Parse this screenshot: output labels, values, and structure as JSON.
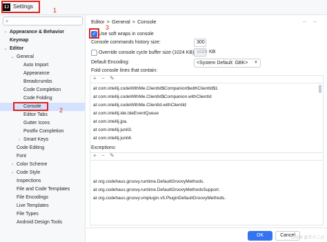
{
  "window": {
    "title": "Settings",
    "app_icon": "IJ"
  },
  "annotations": {
    "n1": "1",
    "n2": "2",
    "n3": "3"
  },
  "sidebar": {
    "items": [
      {
        "label": "Appearance & Behavior",
        "chev": ">",
        "bold": true,
        "indent": 0
      },
      {
        "label": "Keymap",
        "chev": "",
        "bold": true,
        "indent": 0
      },
      {
        "label": "Editor",
        "chev": "v",
        "bold": true,
        "indent": 0
      },
      {
        "label": "General",
        "chev": "v",
        "bold": false,
        "indent": 1
      },
      {
        "label": "Auto Import",
        "chev": "",
        "bold": false,
        "indent": 2
      },
      {
        "label": "Appearance",
        "chev": "",
        "bold": false,
        "indent": 2
      },
      {
        "label": "Breadcrumbs",
        "chev": "",
        "bold": false,
        "indent": 2
      },
      {
        "label": "Code Completion",
        "chev": "",
        "bold": false,
        "indent": 2
      },
      {
        "label": "Code Folding",
        "chev": "",
        "bold": false,
        "indent": 2
      },
      {
        "label": "Console",
        "chev": "",
        "bold": false,
        "indent": 2,
        "selected": true
      },
      {
        "label": "Editor Tabs",
        "chev": "",
        "bold": false,
        "indent": 2
      },
      {
        "label": "Gutter Icons",
        "chev": "",
        "bold": false,
        "indent": 2
      },
      {
        "label": "Postfix Completion",
        "chev": "",
        "bold": false,
        "indent": 2
      },
      {
        "label": "Smart Keys",
        "chev": ">",
        "bold": false,
        "indent": 2
      },
      {
        "label": "Code Editing",
        "chev": "",
        "bold": false,
        "indent": 1
      },
      {
        "label": "Font",
        "chev": "",
        "bold": false,
        "indent": 1
      },
      {
        "label": "Color Scheme",
        "chev": ">",
        "bold": false,
        "indent": 1
      },
      {
        "label": "Code Style",
        "chev": ">",
        "bold": false,
        "indent": 1
      },
      {
        "label": "Inspections",
        "chev": "",
        "bold": false,
        "indent": 1
      },
      {
        "label": "File and Code Templates",
        "chev": "",
        "bold": false,
        "indent": 1
      },
      {
        "label": "File Encodings",
        "chev": "",
        "bold": false,
        "indent": 1
      },
      {
        "label": "Live Templates",
        "chev": "",
        "bold": false,
        "indent": 1
      },
      {
        "label": "File Types",
        "chev": "",
        "bold": false,
        "indent": 1
      },
      {
        "label": "Android Design Tools",
        "chev": "",
        "bold": false,
        "indent": 1
      }
    ]
  },
  "breadcrumb": [
    "Editor",
    ">",
    "General",
    ">",
    "Console"
  ],
  "nav": {
    "back": "←",
    "forward": "→"
  },
  "settings": {
    "soft_wraps_label": "Use soft wraps in console",
    "soft_wraps_checked": true,
    "history_label": "Console commands history size:",
    "history_value": "300",
    "override_label": "Override console cycle buffer size (1024 KB):",
    "override_checked": false,
    "buffer_value": "1024",
    "buffer_unit": "KB",
    "encoding_label": "Default Encoding:",
    "encoding_value": "<System Default: GBK>",
    "fold_label": "Fold console lines that contain:",
    "exceptions_label": "Exceptions:"
  },
  "toolbar": {
    "add": "+",
    "remove": "−",
    "edit": "✎"
  },
  "fold_lines": [
    "at com.intellij.codeWithMe.ClientId$Companion$withClientId$1",
    "at com.intellij.codeWithMe.ClientId$Companion.withClientId",
    "at com.intellij.codeWithMe.ClientId.withClientId",
    "at com.intellij.ide.IdeEventQueue",
    "at com.intellij.jpa.",
    "at com.intellij.junit3.",
    "at com.intellij.junit4."
  ],
  "exceptions": [
    "at org.codehaus.groovy.runtime.DefaultGroovyMethods.",
    "at org.codehaus.groovy.runtime.DefaultGroovyMethodsSupport.",
    "at org.codehaus.groovy.vmplugin.v5.PluginDefaultGroovyMethods."
  ],
  "buttons": {
    "ok": "OK",
    "cancel": "Cancel"
  },
  "watermark": "CSDN @王小二(1"
}
